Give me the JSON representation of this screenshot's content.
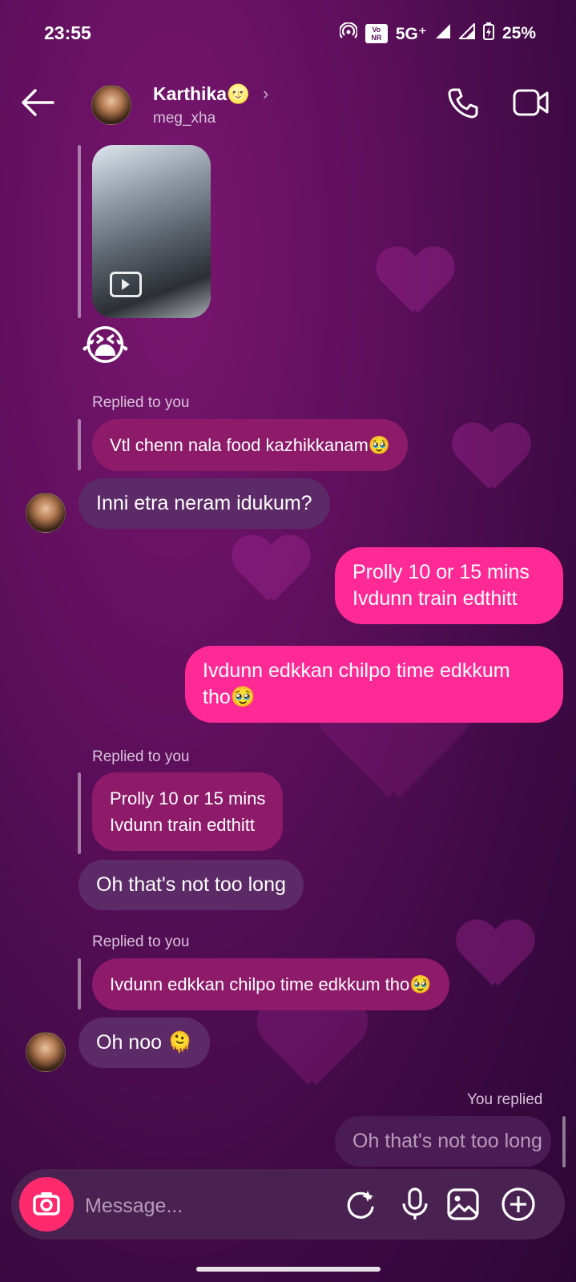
{
  "status_bar": {
    "time": "23:55",
    "network": "5G⁺",
    "battery": "25%",
    "volte_badge": "Vo NR"
  },
  "header": {
    "name": "Karthika",
    "name_emoji": "🌝",
    "handle": "meg_xha"
  },
  "conversation": {
    "media_emoji": "😭",
    "replied_label": "Replied to you",
    "quote_1": "Vtl chenn nala food kazhikkanam🥹",
    "recv_1": "Inni etra neram idukum?",
    "sent_1_line1": "Prolly 10 or 15 mins",
    "sent_1_line2": "Ivdunn train edthitt",
    "sent_2_line1": "Ivdunn edkkan chilpo time edkkum",
    "sent_2_line2": "tho🥹",
    "quote_2_line1": "Prolly 10 or 15 mins",
    "quote_2_line2": "Ivdunn train edthitt",
    "recv_2": "Oh that's not too long",
    "quote_3": "Ivdunn edkkan chilpo time edkkum tho🥹",
    "recv_3": "Oh noo 🫠",
    "you_replied_label": "You replied",
    "sent_3": "Oh that's not too long"
  },
  "composer": {
    "placeholder": "Message..."
  },
  "colors": {
    "sent": "#ff2a95",
    "received": "#5c2a66",
    "quote": "#8e1a6a",
    "camera": "#ff2a6e"
  },
  "icons": [
    "back-arrow-icon",
    "chevron-right-icon",
    "phone-icon",
    "video-call-icon",
    "camera-icon",
    "sticker-icon",
    "microphone-icon",
    "gallery-icon",
    "plus-icon"
  ]
}
